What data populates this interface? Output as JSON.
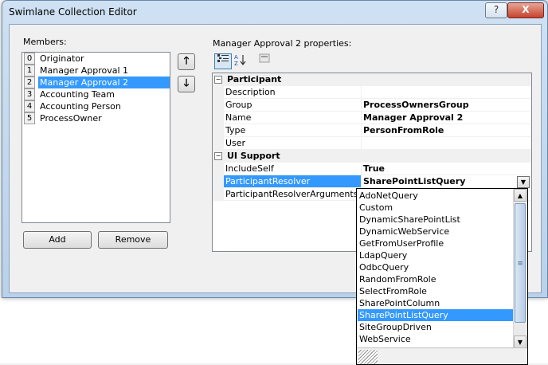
{
  "window": {
    "title": "Swimlane Collection Editor",
    "help_glyph": "?",
    "close_glyph": "X"
  },
  "members": {
    "label": "Members:",
    "items": [
      {
        "index": "0",
        "label": "Originator"
      },
      {
        "index": "1",
        "label": "Manager Approval 1"
      },
      {
        "index": "2",
        "label": "Manager Approval 2"
      },
      {
        "index": "3",
        "label": "Accounting Team"
      },
      {
        "index": "4",
        "label": "Accounting Person"
      },
      {
        "index": "5",
        "label": "ProcessOwner"
      }
    ],
    "selected_index": 2,
    "add_label": "Add",
    "remove_label": "Remove",
    "up_glyph": "🡑",
    "down_glyph": "🡓"
  },
  "properties": {
    "label": "Manager Approval 2 properties:",
    "categories": [
      {
        "name": "Participant",
        "rows": [
          {
            "name": "Description",
            "value": ""
          },
          {
            "name": "Group",
            "value": "ProcessOwnersGroup"
          },
          {
            "name": "Name",
            "value": "Manager Approval 2"
          },
          {
            "name": "Type",
            "value": "PersonFromRole"
          },
          {
            "name": "User",
            "value": ""
          }
        ]
      },
      {
        "name": "UI Support",
        "rows": [
          {
            "name": "IncludeSelf",
            "value": "True"
          },
          {
            "name": "ParticipantResolver",
            "value": "SharePointListQuery"
          },
          {
            "name": "ParticipantResolverArguments",
            "value": ""
          }
        ]
      }
    ],
    "toggle_glyph": "−"
  },
  "dropdown": {
    "options": [
      "AdoNetQuery",
      "Custom",
      "DynamicSharePointList",
      "DynamicWebService",
      "GetFromUserProfile",
      "LdapQuery",
      "OdbcQuery",
      "RandomFromRole",
      "SelectFromRole",
      "SharePointColumn",
      "SharePointListQuery",
      "SiteGroupDriven",
      "WebService"
    ],
    "selected": "SharePointListQuery"
  },
  "colors": {
    "selection": "#3399ff",
    "title_gradient": "#cfe1f3"
  }
}
